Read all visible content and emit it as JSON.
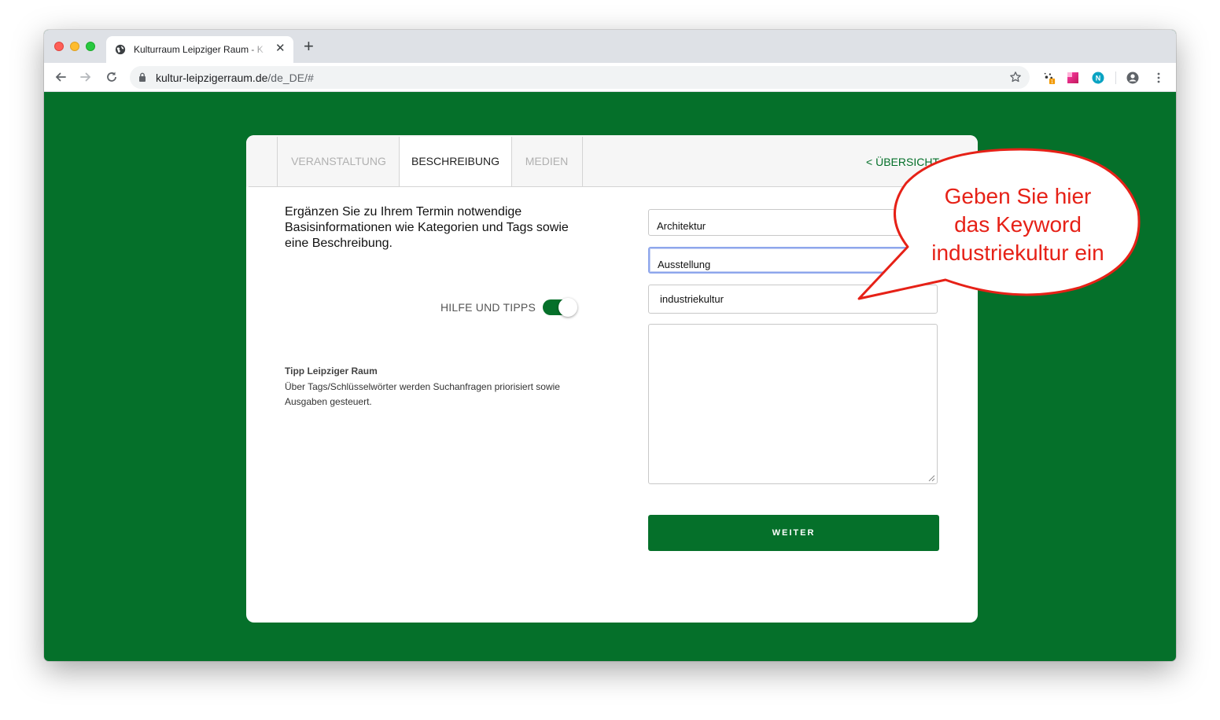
{
  "browser": {
    "tab_title": "Kulturraum Leipziger Raum - K",
    "new_tab": "+",
    "url_domain": "kultur-leipzigerraum.de",
    "url_path": "/de_DE/#",
    "extension_badge": "1",
    "extension_letter": "N"
  },
  "form": {
    "tabs": [
      {
        "label": "VERANSTALTUNG",
        "active": false
      },
      {
        "label": "BESCHREIBUNG",
        "active": true
      },
      {
        "label": "MEDIEN",
        "active": false
      }
    ],
    "overview_link": "< ÜBERSICHT",
    "intro": "Ergänzen Sie zu Ihrem Termin notwendige Basisinformationen wie Kategorien und Tags sowie eine Beschreibung.",
    "help_label": "HILFE UND TIPPS",
    "help_enabled": true,
    "tip_title": "Tipp Leipziger Raum",
    "tip_text": "Über Tags/Schlüsselwörter werden Suchanfragen priorisiert sowie Ausgaben gesteuert.",
    "category_1": "Architektur",
    "category_2": "Ausstellung",
    "keyword_value": "industriekultur",
    "description_value": "",
    "next_button": "WEITER"
  },
  "callout": {
    "line1": "Geben Sie hier",
    "line2": "das Keyword",
    "line3": "industriekultur ein"
  },
  "colors": {
    "brand_green": "#05702a",
    "callout_red": "#e62117"
  }
}
